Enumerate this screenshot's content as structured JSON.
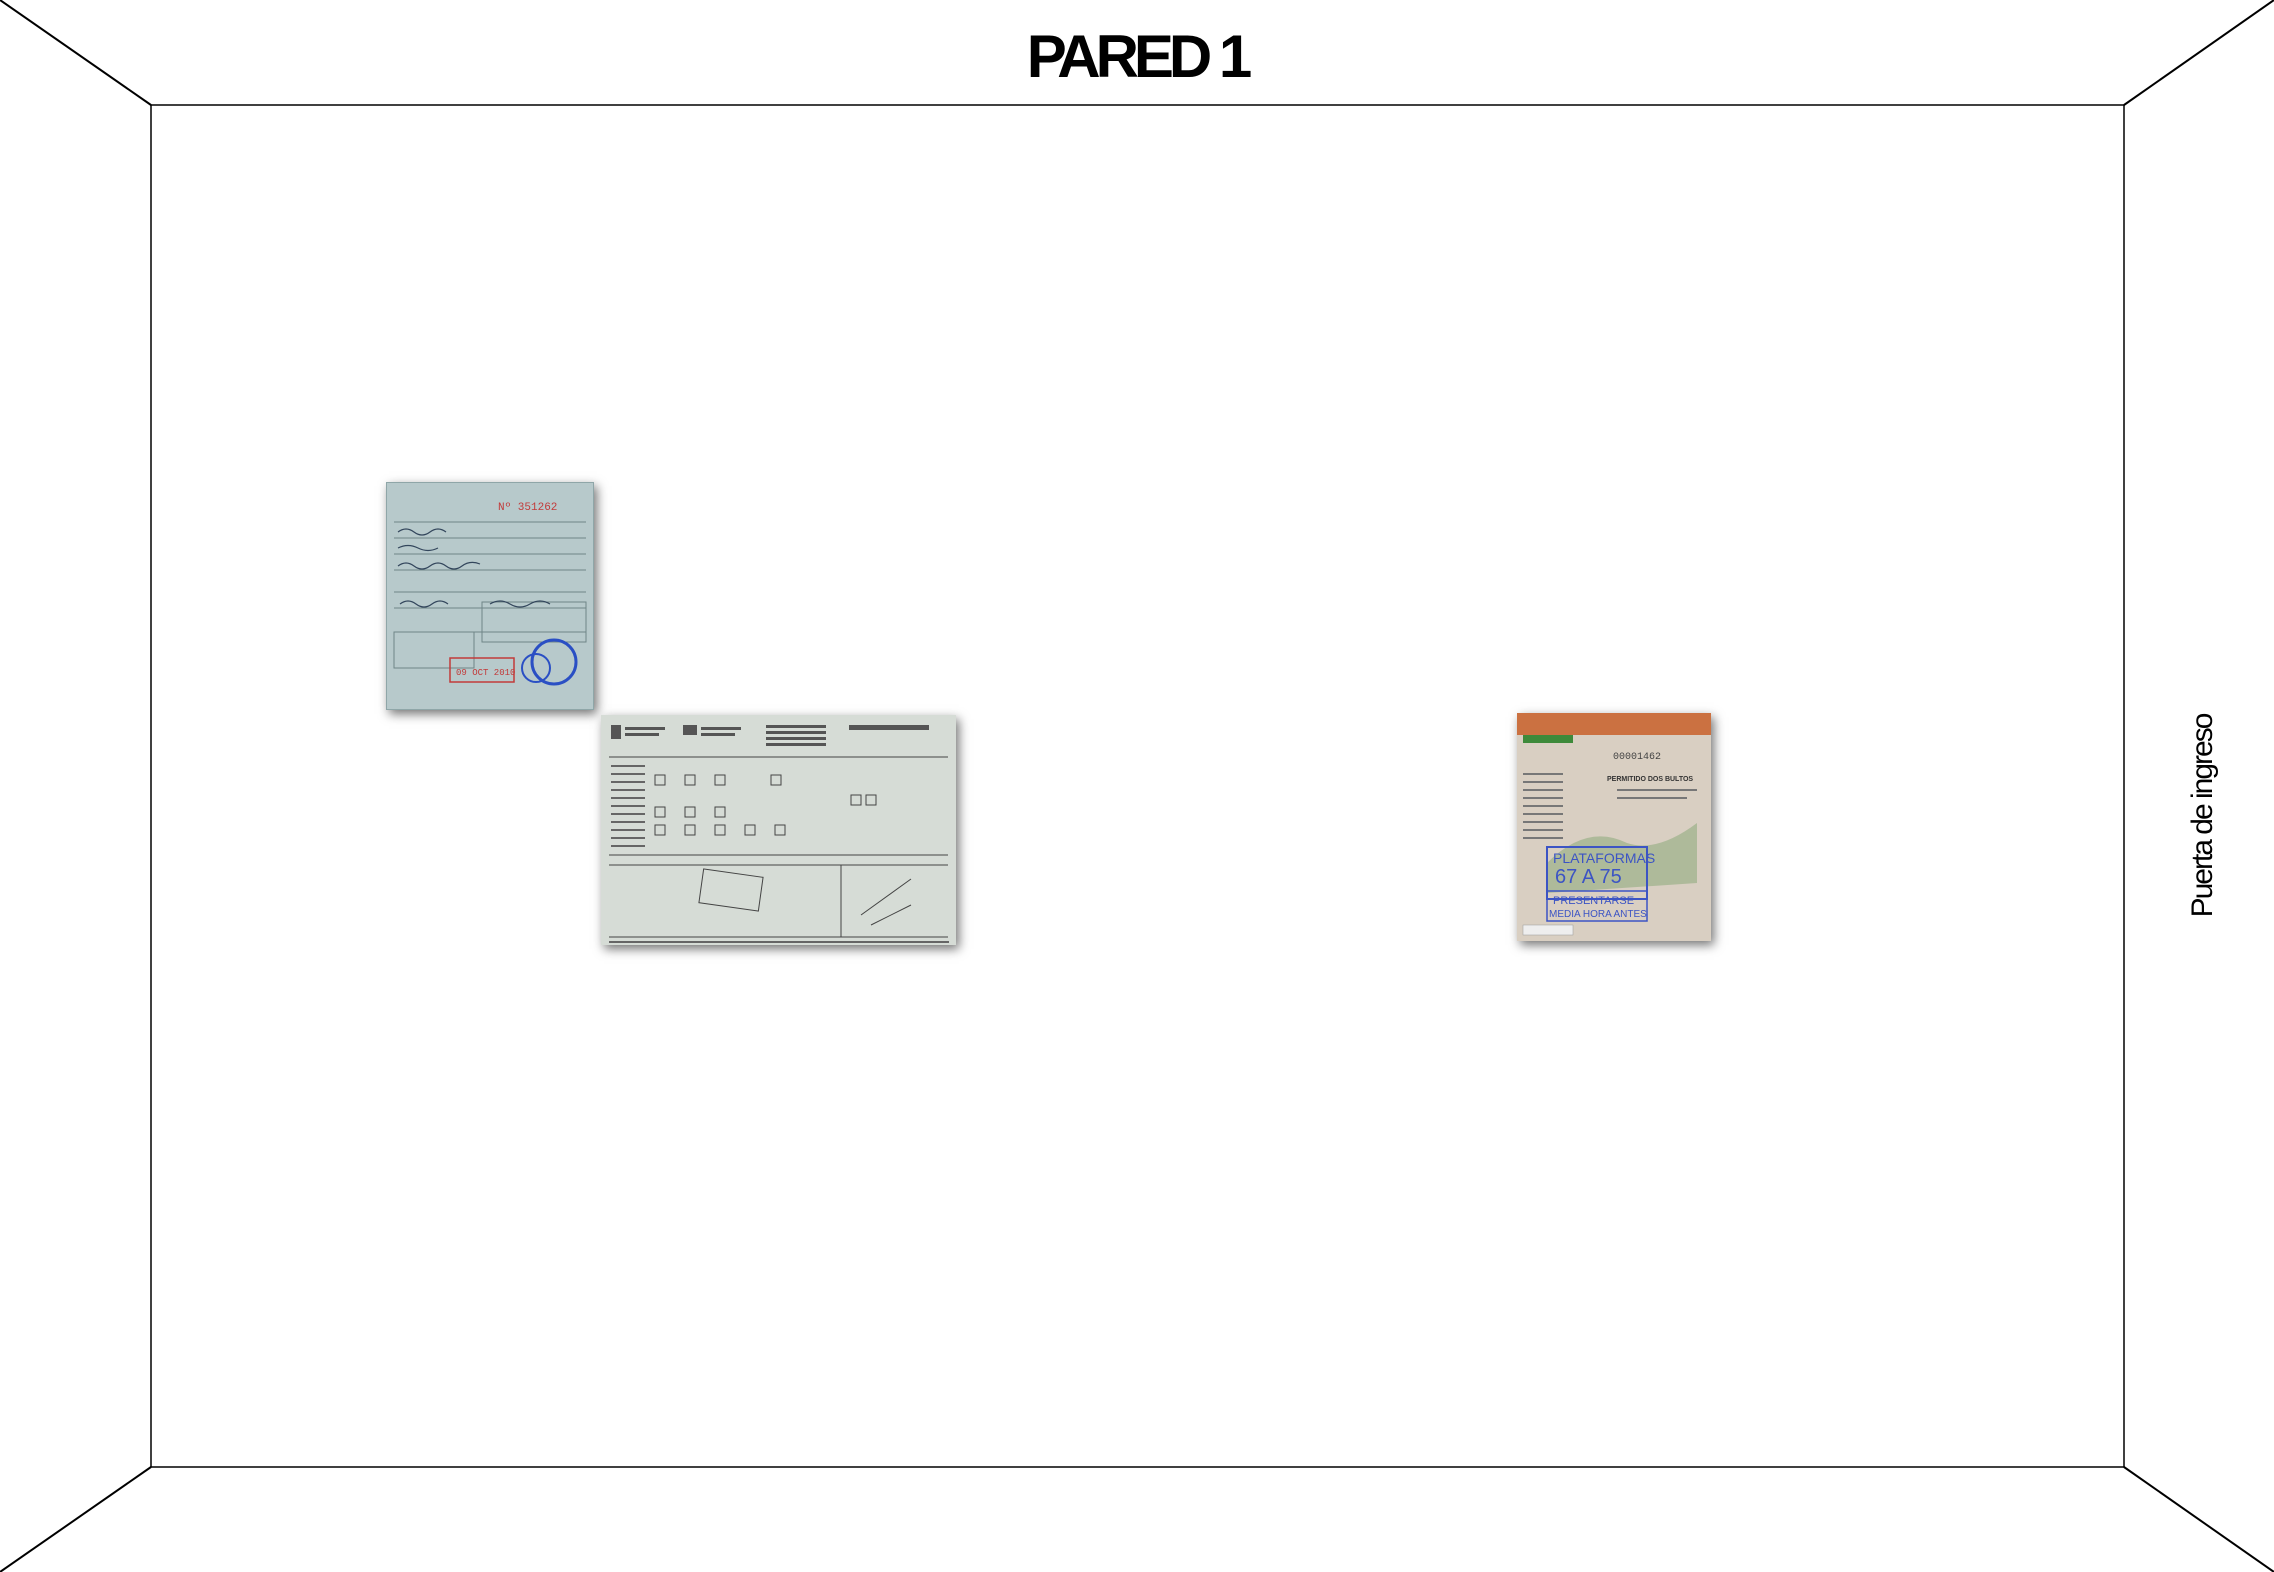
{
  "wall": {
    "title": "PARED 1",
    "door_label": "Puerta de ingreso"
  },
  "documents": [
    {
      "name": "migration-card",
      "serial": "Nº 351262",
      "date_stamp": "09 OCT 2010",
      "colors": {
        "paper": "#b7c9cb",
        "serial": "#c23a3a",
        "stamp": "#2a4fc4"
      }
    },
    {
      "name": "immigration-form",
      "colors": {
        "paper": "#d6dcd6",
        "ink": "#444444"
      }
    },
    {
      "name": "bus-ticket",
      "serial": "00001462",
      "heading": "PERMITIDO DOS BULTOS",
      "stamp_line_1": "PLATAFORMAS",
      "stamp_line_2": "67 A 75",
      "stamp_line_3": "PRESENTARSE",
      "stamp_line_4": "MEDIA HORA ANTES",
      "colors": {
        "paper": "#d9cfc2",
        "stamp": "#3c54c4",
        "brand": "#c8602a"
      }
    }
  ]
}
